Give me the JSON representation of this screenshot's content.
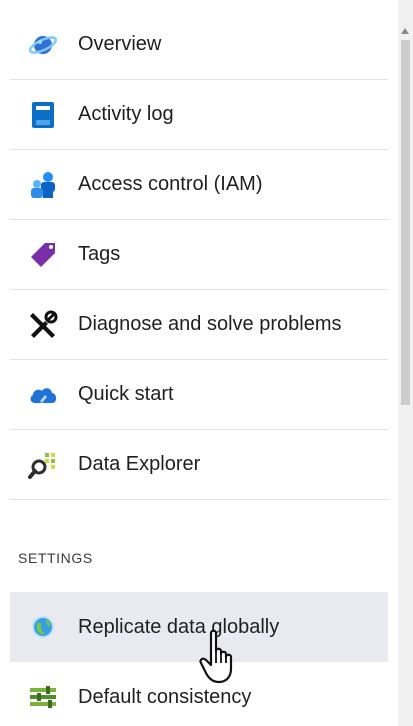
{
  "menu": {
    "items": [
      {
        "label": "Overview",
        "icon": "overview-planet-icon"
      },
      {
        "label": "Activity log",
        "icon": "activity-log-icon"
      },
      {
        "label": "Access control (IAM)",
        "icon": "access-control-icon"
      },
      {
        "label": "Tags",
        "icon": "tag-icon"
      },
      {
        "label": "Diagnose and solve problems",
        "icon": "wrench-screwdriver-icon"
      },
      {
        "label": "Quick start",
        "icon": "cloud-icon"
      },
      {
        "label": "Data Explorer",
        "icon": "data-explorer-icon"
      }
    ]
  },
  "settings": {
    "header": "SETTINGS",
    "items": [
      {
        "label": "Replicate data globally",
        "icon": "globe-icon",
        "selected": true
      },
      {
        "label": "Default consistency",
        "icon": "consistency-sliders-icon"
      }
    ]
  },
  "colors": {
    "selected_background": "#e8eaef",
    "divider": "#e3e3e3",
    "azure_blue": "#0072c6"
  }
}
